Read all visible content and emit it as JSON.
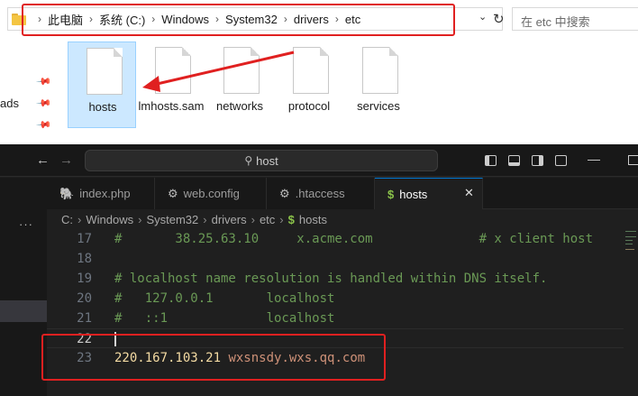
{
  "explorer": {
    "breadcrumb": [
      "此电脑",
      "系统 (C:)",
      "Windows",
      "System32",
      "drivers",
      "etc"
    ],
    "search_placeholder": "在 etc 中搜索",
    "nav_partial_label": "ads",
    "files": [
      {
        "name": "hosts",
        "selected": true
      },
      {
        "name": "lmhosts.sam",
        "selected": false
      },
      {
        "name": "networks",
        "selected": false
      },
      {
        "name": "protocol",
        "selected": false
      },
      {
        "name": "services",
        "selected": false
      }
    ],
    "annotation_color": "#e02020"
  },
  "vscode": {
    "search_text": "host",
    "tabs": [
      {
        "label": "index.php",
        "icon": "php-icon",
        "active": false
      },
      {
        "label": "web.config",
        "icon": "gear-icon",
        "active": false
      },
      {
        "label": ".htaccess",
        "icon": "file-icon",
        "active": false
      },
      {
        "label": "hosts",
        "icon": "dollar-icon",
        "active": true
      }
    ],
    "breadcrumb": [
      "C:",
      "Windows",
      "System32",
      "drivers",
      "etc",
      "hosts"
    ],
    "lines": [
      {
        "num": "17",
        "text": "#       38.25.63.10     x.acme.com              # x client host"
      },
      {
        "num": "18",
        "text": ""
      },
      {
        "num": "19",
        "text": "# localhost name resolution is handled within DNS itself."
      },
      {
        "num": "20",
        "text": "#   127.0.0.1       localhost"
      },
      {
        "num": "21",
        "text": "#   ::1             localhost"
      },
      {
        "num": "22",
        "text": ""
      },
      {
        "num": "23",
        "ip": "220.167.103.21",
        "host": "wxsnsdy.wxs.qq.com"
      }
    ],
    "colors": {
      "comment": "#6a9955",
      "ip": "#f4dba3",
      "hostname": "#ce9178",
      "accent": "#0078d4"
    }
  }
}
